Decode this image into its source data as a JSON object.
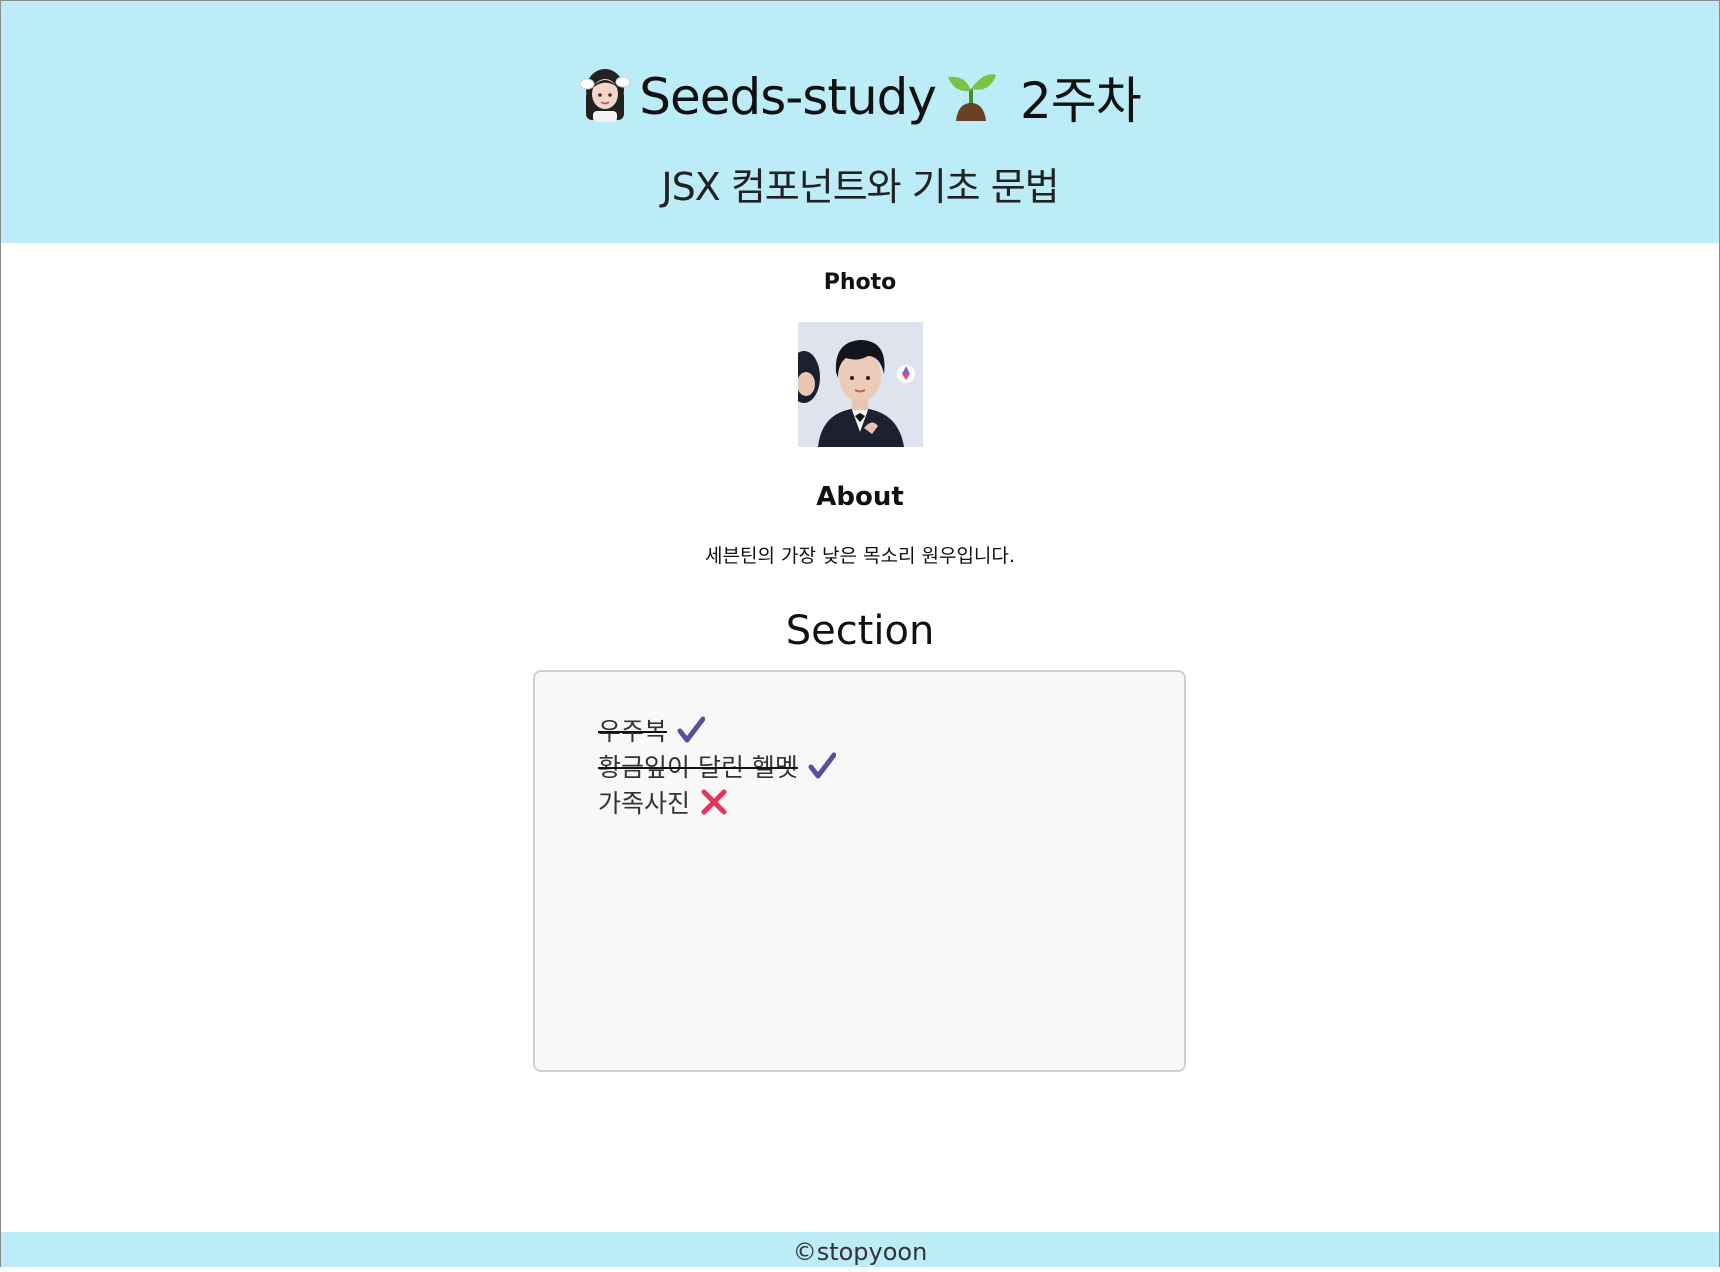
{
  "header": {
    "title": "Seeds-study",
    "title_suffix": "2주차",
    "title_icons": [
      "person-emoji-icon",
      "seedling-icon"
    ],
    "subtitle": "JSX 컴포넌트와 기초 문법",
    "background": "#bcecf8"
  },
  "photo": {
    "heading": "Photo",
    "alt": "profile photo"
  },
  "about": {
    "heading": "About",
    "text": "세븐틴의 가장 낮은 목소리 원우입니다."
  },
  "section": {
    "heading": "Section",
    "items": [
      {
        "label": "우주복",
        "done": true,
        "icon": "check-icon"
      },
      {
        "label": "황금잎이 달린 헬멧",
        "done": true,
        "icon": "check-icon"
      },
      {
        "label": "가족사진",
        "done": false,
        "icon": "cross-icon"
      }
    ],
    "check_color": "#5b4e9a",
    "cross_color": "#e8345a"
  },
  "footer": {
    "text": "©stopyoon"
  }
}
